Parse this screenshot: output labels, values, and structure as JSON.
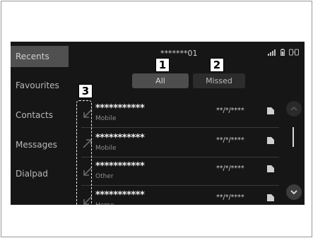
{
  "sidebar": {
    "items": [
      {
        "label": "Recents",
        "active": true
      },
      {
        "label": "Favourites",
        "active": false
      },
      {
        "label": "Contacts",
        "active": false
      },
      {
        "label": "Messages",
        "active": false
      },
      {
        "label": "Dialpad",
        "active": false
      }
    ]
  },
  "header": {
    "title": "*******01",
    "signal_icon": "signal-bars-icon",
    "battery_icon": "battery-icon",
    "phone_icon": "phone-link-icon"
  },
  "tabs": [
    {
      "label": "All",
      "selected": true
    },
    {
      "label": "Missed",
      "selected": false
    }
  ],
  "callouts": {
    "one": "1",
    "two": "2",
    "three": "3"
  },
  "calls": [
    {
      "name": "***********",
      "type": "Mobile",
      "datetime": "**/*/****",
      "direction_icon": "incoming-call-icon"
    },
    {
      "name": "***********",
      "type": "Mobile",
      "datetime": "**/*/****",
      "direction_icon": "outgoing-call-icon"
    },
    {
      "name": "***********",
      "type": "Other",
      "datetime": "**/*/****",
      "direction_icon": "incoming-call-icon"
    },
    {
      "name": "***********",
      "type": "Home",
      "datetime": "**/*/****",
      "direction_icon": "incoming-call-icon"
    }
  ],
  "colors": {
    "screen_bg": "#161616",
    "active_sidebar": "#505050",
    "text": "#ededed"
  }
}
